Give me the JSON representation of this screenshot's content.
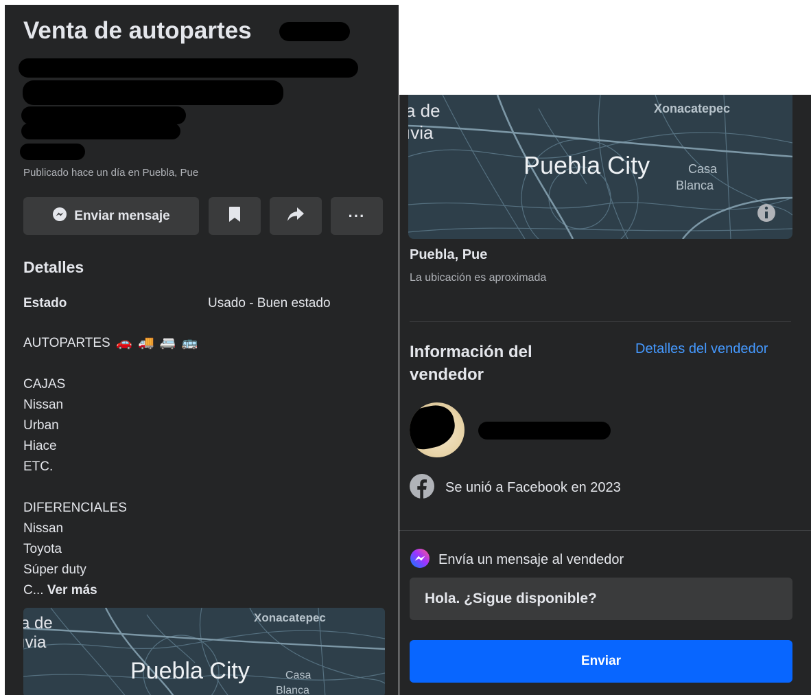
{
  "listing": {
    "title_visible": "Venta de autopartes",
    "posted": "Publicado hace un día en Puebla, Pue"
  },
  "actions": {
    "message_label": "Enviar mensaje",
    "more_label": "···",
    "icons": [
      "messenger-icon",
      "bookmark-icon",
      "share-icon",
      "more-icon"
    ]
  },
  "details": {
    "heading": "Detalles",
    "state_label": "Estado",
    "state_value": "Usado - Buen estado",
    "description": {
      "line1": "AUTOPARTES",
      "vehicle_emojis": [
        "🚗",
        "🚚",
        "🚐",
        "🚌"
      ],
      "cajas_header": "CAJAS",
      "cajas": [
        "Nissan",
        "Urban",
        "Hiace",
        "ETC."
      ],
      "diferenciales_header": "DIFERENCIALES",
      "diferenciales": [
        "Nissan",
        "Toyota",
        "Súper duty"
      ],
      "truncated": "C...",
      "see_more": "Ver más"
    }
  },
  "map": {
    "city_label": "Puebla City",
    "place1": "Xonacatepec",
    "place2_line1": "Casa",
    "place2_line2": "Blanca",
    "edge_line1": "a de",
    "edge_line2": "ıvia"
  },
  "location": {
    "name": "Puebla, Pue",
    "note": "La ubicación es aproximada"
  },
  "seller": {
    "heading": "Información del vendedor",
    "details_link": "Detalles del vendedor",
    "joined": "Se unió a Facebook en 2023"
  },
  "message": {
    "prompt": "Envía un mensaje al vendedor",
    "input_value": "Hola. ¿Sigue disponible?",
    "send_label": "Enviar"
  },
  "colors": {
    "panel_bg": "#242526",
    "button_bg": "#3a3b3c",
    "primary_text": "#e4e6eb",
    "secondary_text": "#b0b3b8",
    "link": "#4599ff",
    "send_button": "#0866ff"
  }
}
